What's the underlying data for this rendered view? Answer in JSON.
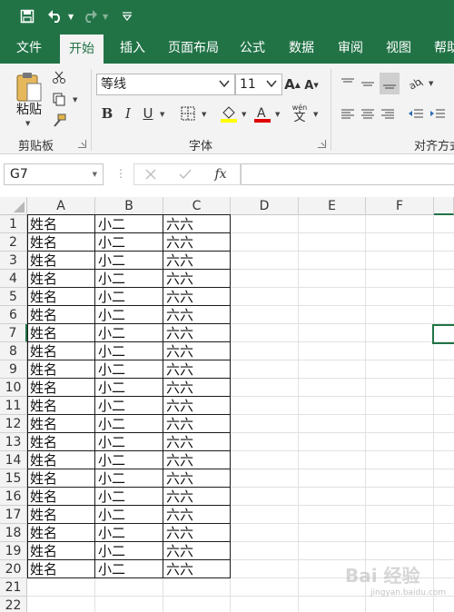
{
  "title_bar": {
    "save_icon": "save-icon",
    "undo_icon": "undo-icon",
    "redo_icon": "redo-icon",
    "customize_icon": "customize-icon"
  },
  "tabs": [
    {
      "label": "文件"
    },
    {
      "label": "开始",
      "active": true
    },
    {
      "label": "插入"
    },
    {
      "label": "页面布局"
    },
    {
      "label": "公式"
    },
    {
      "label": "数据"
    },
    {
      "label": "审阅"
    },
    {
      "label": "视图"
    },
    {
      "label": "帮助"
    }
  ],
  "ribbon": {
    "clipboard": {
      "paste_label": "粘贴",
      "group_label": "剪贴板"
    },
    "font": {
      "font_name": "等线",
      "font_size": "11",
      "group_label": "字体",
      "bold": "B",
      "italic": "I",
      "underline": "U",
      "grow": "A",
      "shrink": "A",
      "phonetic_top": "wén",
      "phonetic_char": "文"
    },
    "alignment": {
      "group_label": "对齐方式"
    }
  },
  "formula_bar": {
    "name_box": "G7",
    "fx": "fx",
    "formula": ""
  },
  "sheet": {
    "columns": [
      "A",
      "B",
      "C",
      "D",
      "E",
      "F"
    ],
    "row_count": 22,
    "rows": [
      [
        "姓名",
        "小二",
        "六六"
      ],
      [
        "姓名",
        "小二",
        "六六"
      ],
      [
        "姓名",
        "小二",
        "六六"
      ],
      [
        "姓名",
        "小二",
        "六六"
      ],
      [
        "姓名",
        "小二",
        "六六"
      ],
      [
        "姓名",
        "小二",
        "六六"
      ],
      [
        "姓名",
        "小二",
        "六六"
      ],
      [
        "姓名",
        "小二",
        "六六"
      ],
      [
        "姓名",
        "小二",
        "六六"
      ],
      [
        "姓名",
        "小二",
        "六六"
      ],
      [
        "姓名",
        "小二",
        "六六"
      ],
      [
        "姓名",
        "小二",
        "六六"
      ],
      [
        "姓名",
        "小二",
        "六六"
      ],
      [
        "姓名",
        "小二",
        "六六"
      ],
      [
        "姓名",
        "小二",
        "六六"
      ],
      [
        "姓名",
        "小二",
        "六六"
      ],
      [
        "姓名",
        "小二",
        "六六"
      ],
      [
        "姓名",
        "小二",
        "六六"
      ],
      [
        "姓名",
        "小二",
        "六六"
      ],
      [
        "姓名",
        "小二",
        "六六"
      ]
    ],
    "selected_cell": "G7"
  },
  "watermark": {
    "text": "Bai 经验",
    "sub": "jingyan.baidu.com"
  },
  "colors": {
    "accent": "#217346",
    "ribbon_bg": "#f3f3f3",
    "border": "#1a1a1a"
  }
}
